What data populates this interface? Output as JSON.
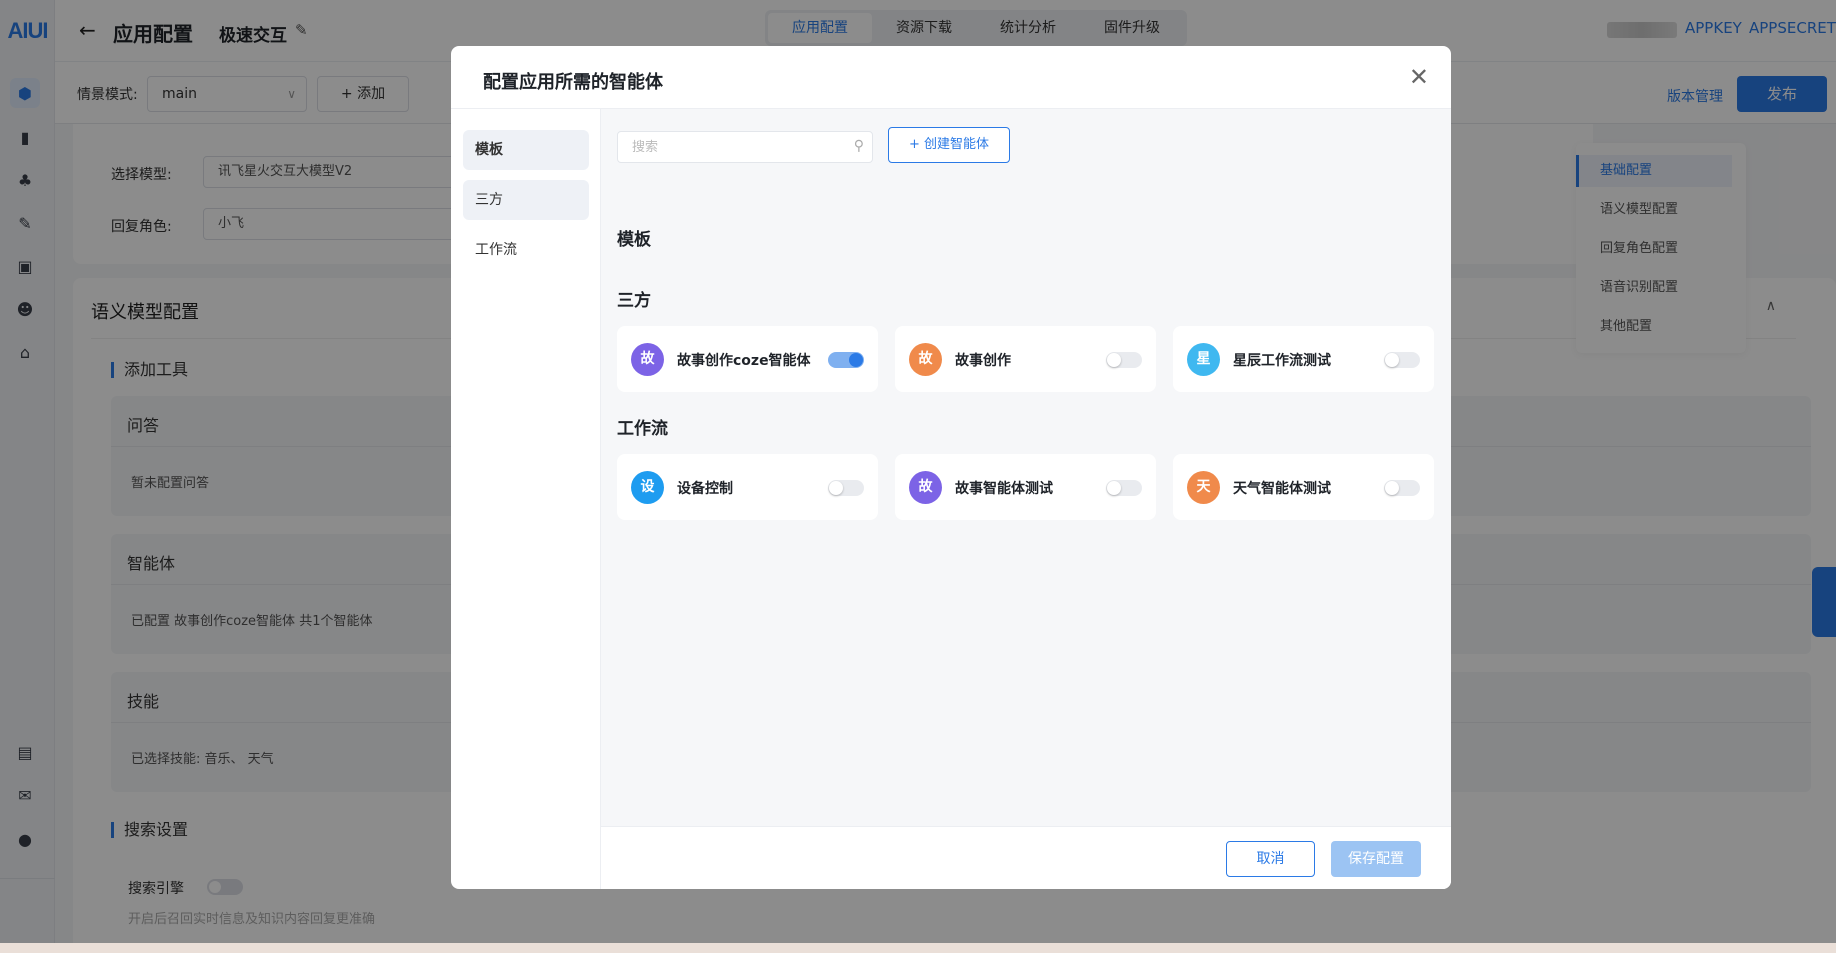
{
  "app": {
    "logo": "AIUI"
  },
  "header": {
    "page_title": "应用配置",
    "app_name": "极速交互",
    "tabs": [
      "应用配置",
      "资源下载",
      "统计分析",
      "固件升级"
    ],
    "appkey": "APPKEY",
    "appsecret": "APPSECRET"
  },
  "subbar": {
    "scene_label": "情景模式:",
    "scene_value": "main",
    "add_label": "+ 添加",
    "version_link": "版本管理",
    "publish_label": "发布"
  },
  "basic_form": {
    "model_label": "选择模型:",
    "model_value": "讯飞星火交互大模型V2",
    "role_label": "回复角色:",
    "role_value": "小飞"
  },
  "semantic": {
    "title": "语义模型配置",
    "add_tools": "添加工具",
    "qa_title": "问答",
    "qa_body": "暂未配置问答",
    "agent_title": "智能体",
    "agent_body": "已配置 故事创作coze智能体 共1个智能体",
    "skill_title": "技能",
    "skill_body": "已选择技能:  音乐、 天气",
    "search_settings": "搜索设置",
    "search_engine_label": "搜索引擎",
    "search_hint": "开启后召回实时信息及知识内容回复更准确"
  },
  "anchor_nav": [
    "基础配置",
    "语义模型配置",
    "回复角色配置",
    "语音识别配置",
    "其他配置"
  ],
  "modal": {
    "title": "配置应用所需的智能体",
    "sidebar": [
      "模板",
      "三方",
      "工作流"
    ],
    "search_placeholder": "搜索",
    "create_label": "+ 创建智能体",
    "groups": {
      "template": "模板",
      "third_party": "三方",
      "workflow": "工作流"
    },
    "third_party_agents": [
      {
        "avatar": "故",
        "name": "故事创作coze智能体",
        "enabled": true,
        "color": "#7c63e6"
      },
      {
        "avatar": "故",
        "name": "故事创作",
        "enabled": false,
        "color": "#f08a4b"
      },
      {
        "avatar": "星",
        "name": "星辰工作流测试",
        "enabled": false,
        "color": "#3fb8f0"
      }
    ],
    "workflow_agents": [
      {
        "avatar": "设",
        "name": "设备控制",
        "enabled": false,
        "color": "#1e9cf0"
      },
      {
        "avatar": "故",
        "name": "故事智能体测试",
        "enabled": false,
        "color": "#7c63e6"
      },
      {
        "avatar": "天",
        "name": "天气智能体测试",
        "enabled": false,
        "color": "#f08a4b"
      }
    ],
    "cancel_label": "取消",
    "save_label": "保存配置"
  },
  "colors": {
    "accent": "#2b7ae6"
  }
}
